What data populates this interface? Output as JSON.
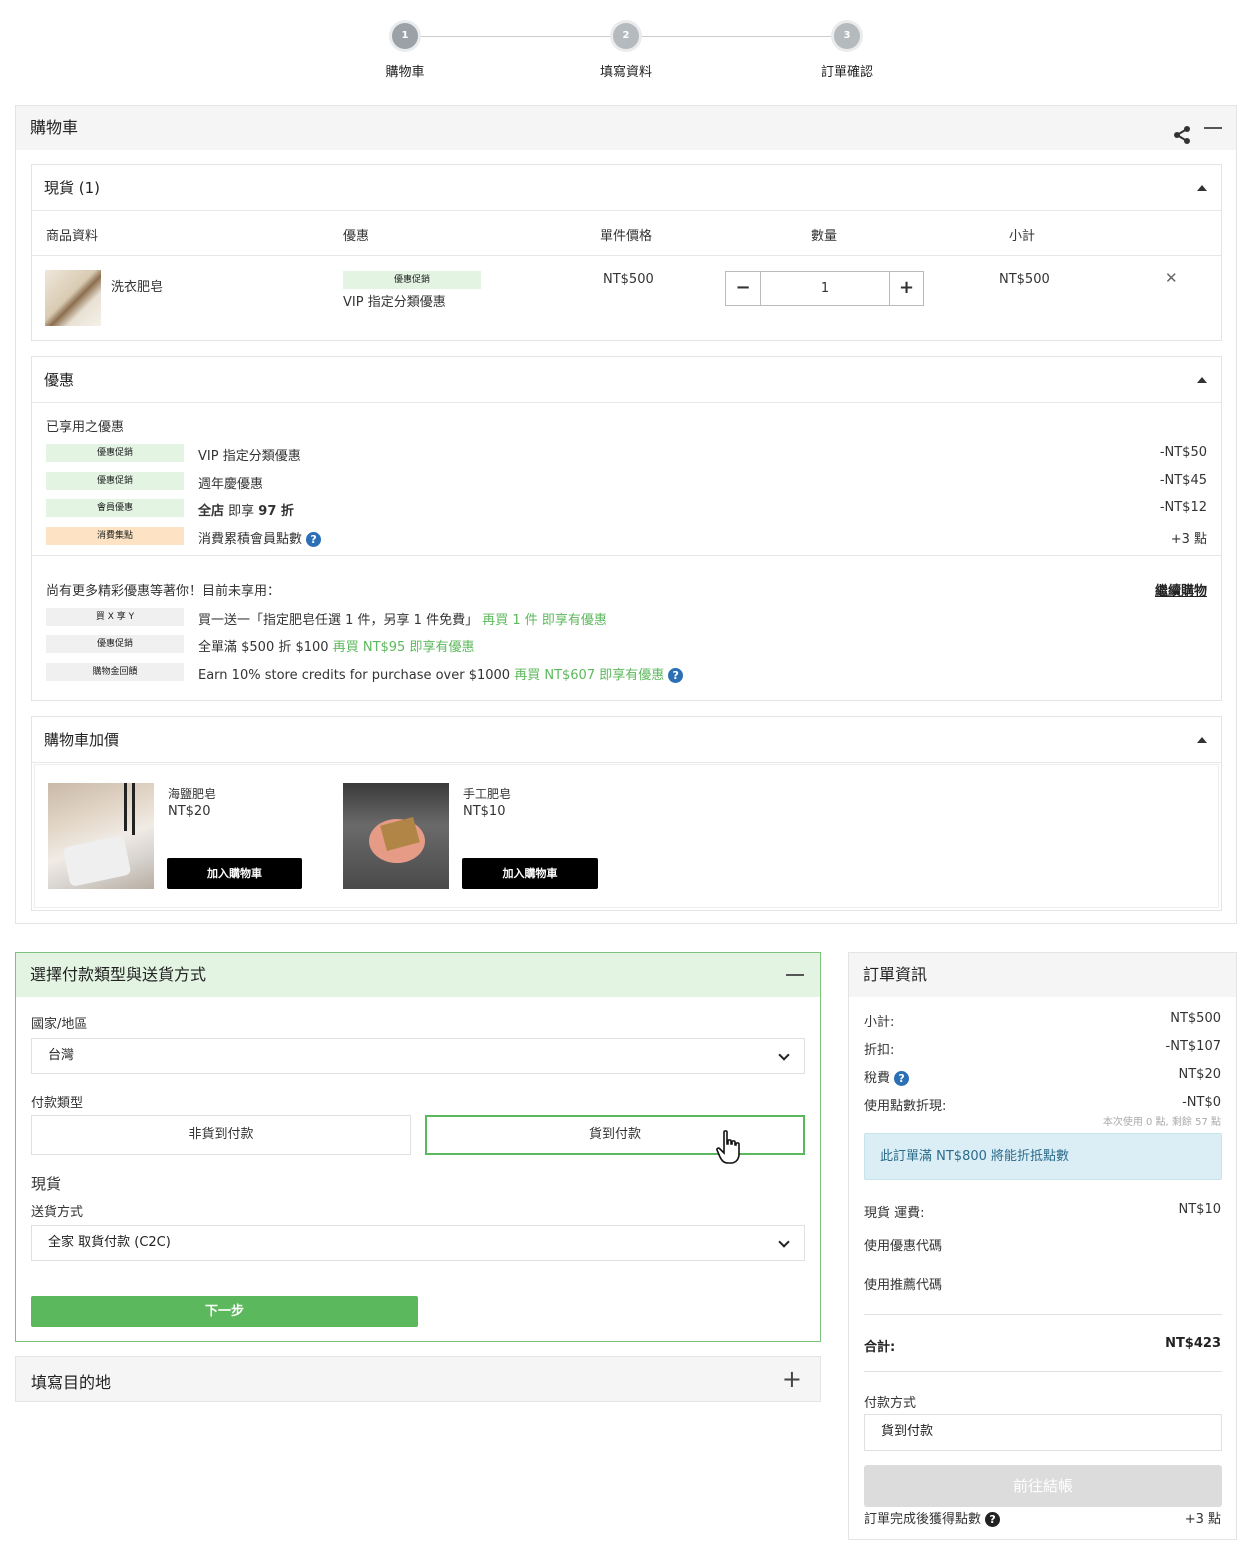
{
  "steps": [
    {
      "num": "1",
      "label": "購物車"
    },
    {
      "num": "2",
      "label": "填寫資料"
    },
    {
      "num": "3",
      "label": "訂單確認"
    }
  ],
  "cart": {
    "title": "購物車",
    "stock": {
      "title": "現貨 (1)",
      "headers": [
        "商品資料",
        "優惠",
        "單件價格",
        "數量",
        "小計"
      ],
      "item": {
        "name": "洗衣肥皂",
        "badge": "優惠促銷",
        "promo": "VIP 指定分類優惠",
        "price": "NT$500",
        "qty": "1",
        "subtotal": "NT$500"
      }
    },
    "promos": {
      "title": "優惠",
      "applied_label": "已享用之優惠",
      "applied": [
        {
          "badge": "優惠促銷",
          "badge_color": "#e3f4e3",
          "text": "VIP 指定分類優惠",
          "amount": "-NT$50"
        },
        {
          "badge": "優惠促銷",
          "badge_color": "#e3f4e3",
          "text": "週年慶優惠",
          "amount": "-NT$45"
        },
        {
          "badge": "會員優惠",
          "badge_color": "#e3f4e3",
          "text_bold1": "全店",
          "text_mid": " 即享 ",
          "text_bold2": "97 折",
          "amount": "-NT$12"
        },
        {
          "badge": "消費集點",
          "badge_color": "#fde3c4",
          "text": "消費累積會員點數",
          "amount": "+3 點"
        }
      ],
      "more_label": "尚有更多精彩優惠等著你！目前未享用：",
      "continue_link": "繼續購物",
      "more": [
        {
          "badge": "買 X 享 Y",
          "text": "買一送一「指定肥皂任選 1 件，另享 1 件免費」",
          "hint": "再買 1 件 即享有優惠"
        },
        {
          "badge": "優惠促銷",
          "text": "全單滿 $500 折 $100",
          "hint": "再買 NT$95 即享有優惠"
        },
        {
          "badge": "購物金回饋",
          "text": "Earn 10% store credits for purchase over $1000",
          "hint": "再買 NT$607 即享有優惠"
        }
      ]
    },
    "addon": {
      "title": "購物車加價",
      "items": [
        {
          "name": "海鹽肥皂",
          "price": "NT$20",
          "button": "加入購物車"
        },
        {
          "name": "手工肥皂",
          "price": "NT$10",
          "button": "加入購物車"
        }
      ]
    }
  },
  "payment": {
    "title": "選擇付款類型與送貨方式",
    "country_label": "國家/地區",
    "country_value": "台灣",
    "type_label": "付款類型",
    "type_options": [
      "非貨到付款",
      "貨到付款"
    ],
    "stock_label": "現貨",
    "shipping_label": "送貨方式",
    "shipping_value": "全家 取貨付款 (C2C)",
    "next_button": "下一步"
  },
  "destination": {
    "title": "填寫目的地"
  },
  "order": {
    "title": "訂單資訊",
    "rows": [
      {
        "label": "小計:",
        "value": "NT$500"
      },
      {
        "label": "折扣:",
        "value": "-NT$107"
      },
      {
        "label": "稅費",
        "value": "NT$20"
      },
      {
        "label": "使用點數折現:",
        "value": "-NT$0"
      }
    ],
    "points_note": "本次使用 0 點, 剩餘 57 點",
    "info_box": "此訂單滿 NT$800 將能折抵點數",
    "shipping_label": "現貨 運費:",
    "shipping_value": "NT$10",
    "coupon_link": "使用優惠代碼",
    "referral_link": "使用推薦代碼",
    "total_label": "合計:",
    "total_value": "NT$423",
    "pay_method_label": "付款方式",
    "pay_method_value": "貨到付款",
    "checkout_button": "前往結帳",
    "earn_label": "訂單完成後獲得點數",
    "earn_value": "+3 點"
  },
  "colors": {
    "accent_green": "#5cb85c",
    "link_blue": "#2b7bb9",
    "info_bg": "#dbeef6"
  }
}
